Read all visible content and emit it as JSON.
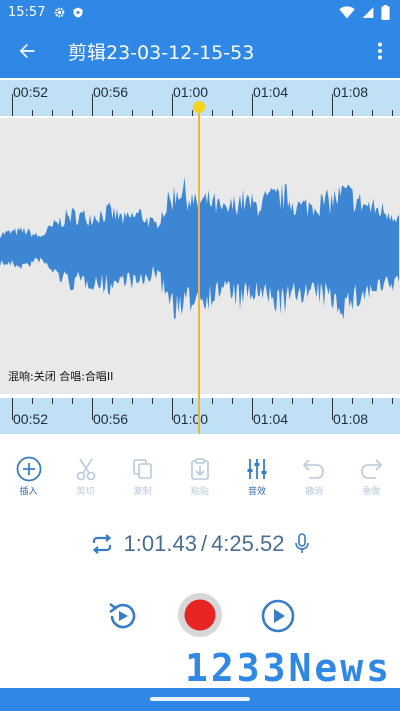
{
  "statusbar": {
    "time": "15:57"
  },
  "appbar": {
    "title": "剪辑23-03-12-15-53"
  },
  "ruler": {
    "labels": [
      "00:52",
      "00:56",
      "01:00",
      "01:04",
      "01:08"
    ]
  },
  "waveform": {
    "effects_text": "混响:关闭 合唱:合唱II"
  },
  "toolbar": {
    "items": [
      {
        "label": "插入",
        "icon": "plus-circle-icon",
        "enabled": true
      },
      {
        "label": "剪切",
        "icon": "scissors-icon",
        "enabled": false
      },
      {
        "label": "复制",
        "icon": "copy-icon",
        "enabled": false
      },
      {
        "label": "粘贴",
        "icon": "paste-icon",
        "enabled": false
      },
      {
        "label": "音效",
        "icon": "equalizer-icon",
        "enabled": true
      },
      {
        "label": "撤消",
        "icon": "undo-icon",
        "enabled": false
      },
      {
        "label": "重做",
        "icon": "redo-icon",
        "enabled": false
      }
    ]
  },
  "timeline": {
    "current": "1:01.43",
    "separator": "/",
    "total": "4:25.52"
  },
  "watermark": {
    "text": "1233News"
  },
  "colors": {
    "primary": "#2f88e6",
    "wave": "#3d86d4",
    "ruler": "#bfe0f5",
    "playhead": "#f4b23a",
    "record": "#e82424"
  }
}
